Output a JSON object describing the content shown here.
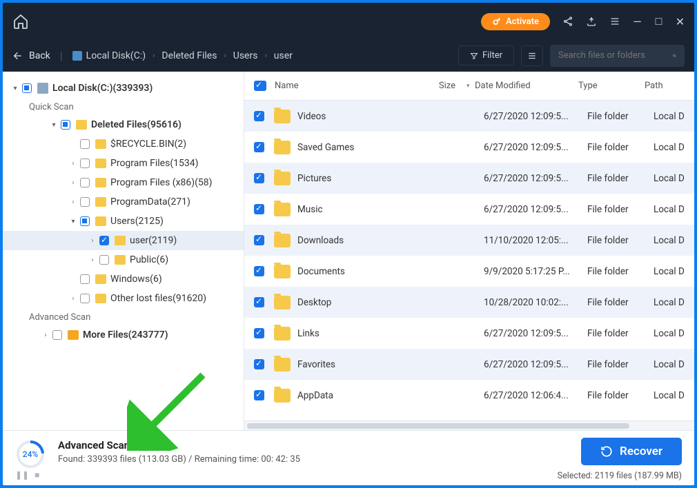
{
  "topbar": {
    "activate_label": "Activate"
  },
  "navbar": {
    "back_label": "Back",
    "breadcrumbs": [
      "Local Disk(C:)",
      "Deleted Files",
      "Users",
      "user"
    ],
    "filter_label": "Filter",
    "search_placeholder": "Search files or folders"
  },
  "tree": {
    "root": {
      "label": "Local Disk(C:)(339393)"
    },
    "quick_scan_label": "Quick Scan",
    "advanced_scan_label": "Advanced Scan",
    "items": [
      {
        "label": "Deleted Files(95616)",
        "indent": 2,
        "bold": true,
        "chev": "▾",
        "partial": true
      },
      {
        "label": "$RECYCLE.BIN(2)",
        "indent": 3
      },
      {
        "label": "Program Files(1534)",
        "indent": 3,
        "chev": "›"
      },
      {
        "label": "Program Files (x86)(58)",
        "indent": 3,
        "chev": "›"
      },
      {
        "label": "ProgramData(271)",
        "indent": 3,
        "chev": "›"
      },
      {
        "label": "Users(2125)",
        "indent": 3,
        "chev": "▾",
        "partial": true
      },
      {
        "label": "user(2119)",
        "indent": 4,
        "chev": "›",
        "checked": true,
        "selected": true
      },
      {
        "label": "Public(6)",
        "indent": 4,
        "chev": "›"
      },
      {
        "label": "Windows(6)",
        "indent": 3
      },
      {
        "label": "Other lost files(91620)",
        "indent": 3,
        "chev": "›"
      }
    ],
    "more_files": {
      "label": "More Files(243777)"
    }
  },
  "table": {
    "headers": {
      "name": "Name",
      "size": "Size",
      "date": "Date Modified",
      "type": "Type",
      "path": "Path"
    },
    "rows": [
      {
        "name": "Videos",
        "date": "6/27/2020 12:09:5...",
        "type": "File folder",
        "path": "Local D"
      },
      {
        "name": "Saved Games",
        "date": "6/27/2020 12:09:5...",
        "type": "File folder",
        "path": "Local D"
      },
      {
        "name": "Pictures",
        "date": "6/27/2020 12:09:5...",
        "type": "File folder",
        "path": "Local D"
      },
      {
        "name": "Music",
        "date": "6/27/2020 12:09:5...",
        "type": "File folder",
        "path": "Local D"
      },
      {
        "name": "Downloads",
        "date": "11/10/2020 12:05:...",
        "type": "File folder",
        "path": "Local D"
      },
      {
        "name": "Documents",
        "date": "9/9/2020 5:17:25 P...",
        "type": "File folder",
        "path": "Local D"
      },
      {
        "name": "Desktop",
        "date": "10/28/2020 10:02:...",
        "type": "File folder",
        "path": "Local D"
      },
      {
        "name": "Links",
        "date": "6/27/2020 12:09:5...",
        "type": "File folder",
        "path": "Local D"
      },
      {
        "name": "Favorites",
        "date": "6/27/2020 12:09:5...",
        "type": "File folder",
        "path": "Local D"
      },
      {
        "name": "AppData",
        "date": "6/27/2020 12:06:4...",
        "type": "File folder",
        "path": "Local D"
      }
    ]
  },
  "footer": {
    "progress_pct": "24%",
    "title": "Advanced Scanning",
    "subtitle": "Found: 339393 files (113.03 GB) / Remaining time: 00: 42: 35",
    "recover_label": "Recover",
    "selected_label": "Selected: 2119 files (187.99 MB)"
  }
}
